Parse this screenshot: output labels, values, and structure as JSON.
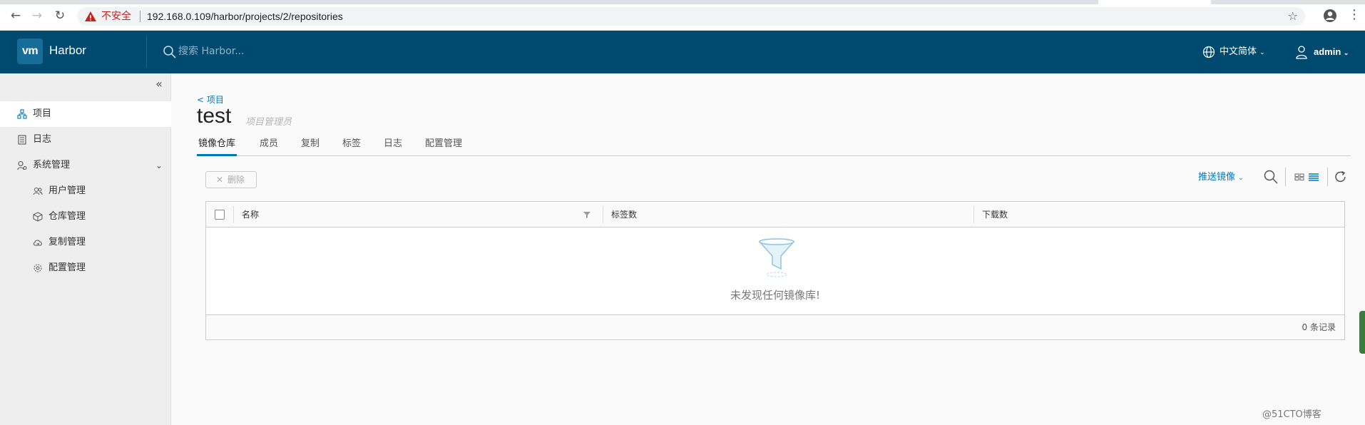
{
  "browser": {
    "insecure_label": "不安全",
    "url": "192.168.0.109/harbor/projects/2/repositories"
  },
  "header": {
    "logo_text": "vm",
    "app_name": "Harbor",
    "search_placeholder": "搜索 Harbor...",
    "language": "中文简体",
    "username": "admin"
  },
  "sidebar": {
    "items": [
      {
        "label": "项目",
        "icon": "projects-icon",
        "active": true
      },
      {
        "label": "日志",
        "icon": "logs-icon",
        "active": false
      },
      {
        "label": "系统管理",
        "icon": "admin-icon",
        "active": false
      }
    ],
    "sub_items": [
      {
        "label": "用户管理",
        "icon": "users-icon"
      },
      {
        "label": "仓库管理",
        "icon": "registries-icon"
      },
      {
        "label": "复制管理",
        "icon": "replication-icon"
      },
      {
        "label": "配置管理",
        "icon": "config-icon"
      }
    ]
  },
  "project": {
    "back_link": "< 项目",
    "name": "test",
    "role": "项目管理员"
  },
  "tabs": [
    "镜像仓库",
    "成员",
    "复制",
    "标签",
    "日志",
    "配置管理"
  ],
  "toolbar": {
    "delete_label": "删除",
    "push_label": "推送镜像"
  },
  "grid": {
    "columns": [
      "名称",
      "标签数",
      "下载数"
    ],
    "empty_message": "未发现任何镜像库!",
    "record_count": "0 条记录"
  },
  "watermark": "@51CTO博客",
  "colors": {
    "header_bg": "#004a70",
    "accent": "#0079b8"
  }
}
